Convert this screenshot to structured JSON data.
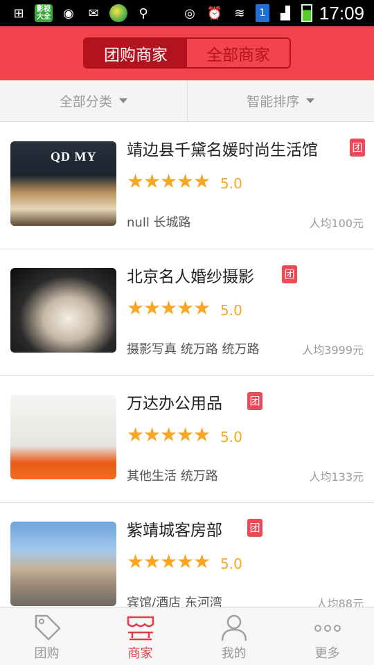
{
  "statusbar": {
    "app_label": "影视大全",
    "sim_label": "1",
    "time": "17:09"
  },
  "header": {
    "tabs": [
      {
        "label": "团购商家",
        "active": true
      },
      {
        "label": "全部商家",
        "active": false
      }
    ]
  },
  "filters": [
    {
      "label": "全部分类"
    },
    {
      "label": "智能排序"
    }
  ],
  "merchants": [
    {
      "name": "靖边县千黛名媛时尚生活馆",
      "badge": "团",
      "rating": 5,
      "score": "5.0",
      "meta": "null 长城路",
      "avg": "人均100元",
      "thumb_label": "QD MY"
    },
    {
      "name": "北京名人婚纱摄影",
      "badge": "团",
      "rating": 5,
      "score": "5.0",
      "meta": "摄影写真 统万路 统万路",
      "avg": "人均3999元"
    },
    {
      "name": "万达办公用品",
      "badge": "团",
      "rating": 5,
      "score": "5.0",
      "meta": "其他生活 统万路",
      "avg": "人均133元"
    },
    {
      "name": "紫靖城客房部",
      "badge": "团",
      "rating": 5,
      "score": "5.0",
      "meta": "宾馆/酒店 东河湾",
      "avg": "人均88元"
    }
  ],
  "bottom_nav": [
    {
      "label": "团购",
      "icon": "tag-icon",
      "active": false
    },
    {
      "label": "商家",
      "icon": "store-icon",
      "active": true
    },
    {
      "label": "我的",
      "icon": "person-icon",
      "active": false
    },
    {
      "label": "更多",
      "icon": "more-dots-icon",
      "active": false
    }
  ],
  "colors": {
    "brand_red": "#f2434e",
    "dark_red": "#b5121f",
    "star": "#f6a623",
    "badge": "#ef4856"
  }
}
